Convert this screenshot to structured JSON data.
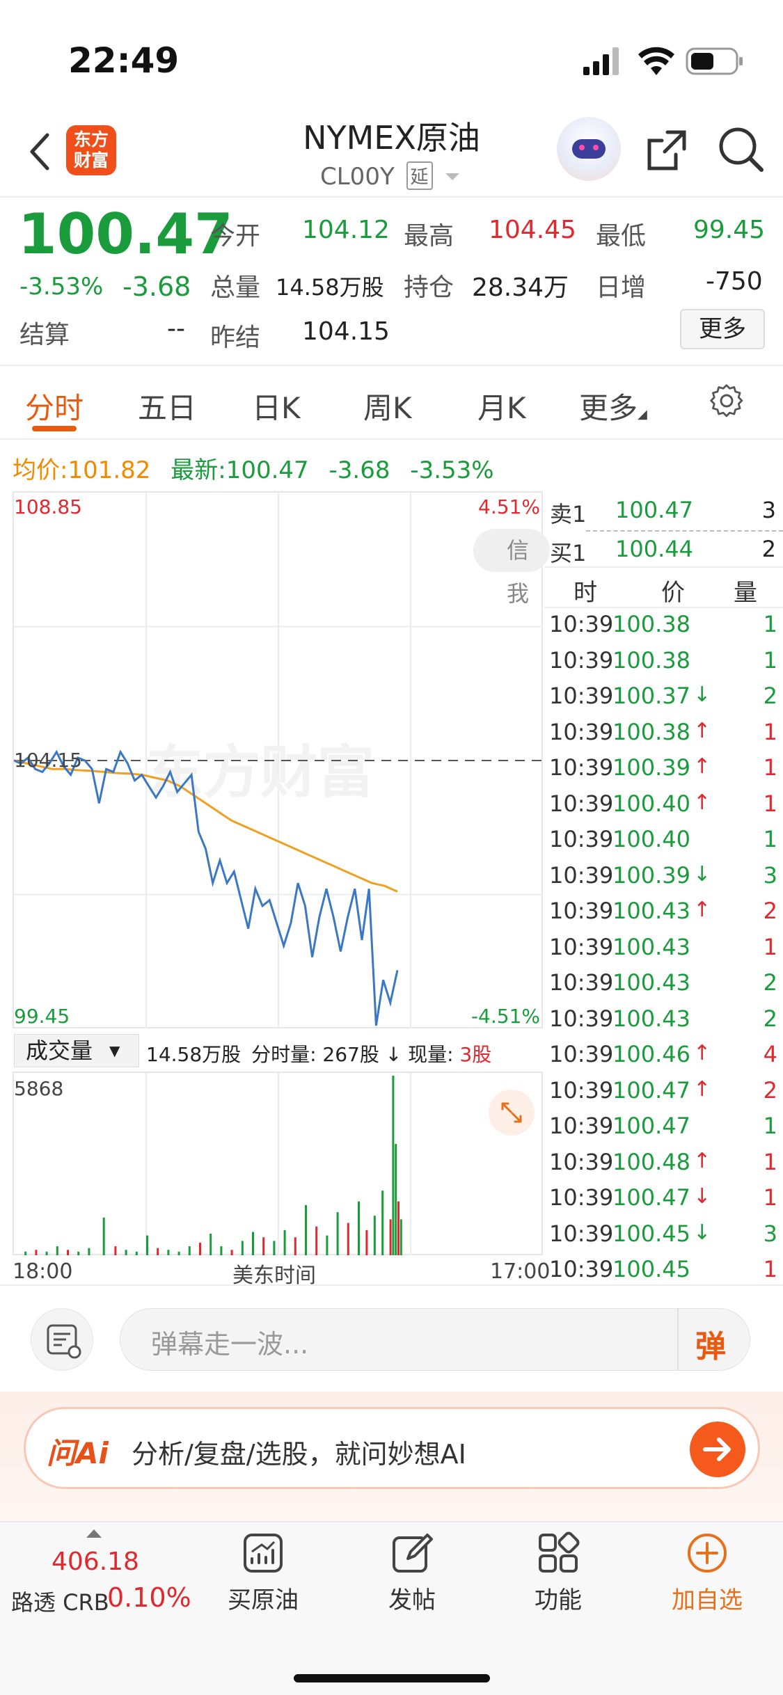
{
  "status_bar": {
    "time": "22:49"
  },
  "header": {
    "brand_logo_text": "东方\n财富",
    "title": "NYMEX原油",
    "symbol": "CL00Y",
    "delay_badge": "延"
  },
  "quote": {
    "price": "100.47",
    "change_pct": "-3.53%",
    "change": "-3.68",
    "settlement_label": "结算",
    "settlement_value": "--",
    "open_label": "今开",
    "open_value": "104.12",
    "high_label": "最高",
    "high_value": "104.45",
    "low_label": "最低",
    "low_value": "99.45",
    "volume_label": "总量",
    "volume_value": "14.58万股",
    "position_label": "持仓",
    "position_value": "28.34万",
    "daily_inc_label": "日增",
    "daily_inc_value": "-750",
    "prev_settle_label": "昨结",
    "prev_settle_value": "104.15",
    "more_button": "更多"
  },
  "tabs": [
    {
      "label": "分时",
      "active": true
    },
    {
      "label": "五日",
      "active": false
    },
    {
      "label": "日K",
      "active": false
    },
    {
      "label": "周K",
      "active": false
    },
    {
      "label": "月K",
      "active": false
    },
    {
      "label": "更多",
      "active": false
    }
  ],
  "info_line": {
    "avg_label": "均价:",
    "avg_value": "101.82",
    "latest_label": "最新:",
    "latest_value": "100.47",
    "latest_change": "-3.68",
    "latest_pct": "-3.53%"
  },
  "chart_data": {
    "type": "line",
    "y_max_label": "108.85",
    "y_min_label": "99.45",
    "y_mid_label": "104.15",
    "pct_max_label": "4.51%",
    "pct_min_label": "-4.51%",
    "ylim": [
      99.45,
      108.85
    ],
    "watermark": "东方财富",
    "pill_text": "信我",
    "x_start_label": "18:00",
    "x_mid_label": "美东时间",
    "x_end_label": "17:00",
    "colors": {
      "price": "#3a78c4",
      "avg": "#f0a020"
    },
    "series": [
      {
        "values": [
          104.15,
          104.1,
          104.2,
          104.0,
          103.95,
          104.1,
          104.3,
          104.05,
          103.9,
          104.2,
          104.15,
          104.0,
          103.4,
          104.0,
          103.95,
          104.3,
          104.1,
          103.8,
          103.9,
          103.7,
          103.5,
          103.7,
          103.95,
          103.6,
          103.75,
          103.9,
          102.9,
          102.6,
          102.0,
          102.4,
          102.0,
          102.2,
          101.7,
          101.2,
          101.9,
          101.6,
          101.7,
          101.3,
          100.9,
          101.3,
          102.0,
          101.6,
          100.7,
          101.4,
          101.9,
          101.4,
          100.8,
          101.4,
          101.9,
          101.0,
          101.9,
          99.5,
          100.3,
          99.9,
          100.47
        ]
      },
      {
        "values": [
          104.15,
          104.1,
          104.05,
          104.0,
          104.0,
          103.98,
          103.97,
          103.95,
          103.93,
          103.92,
          103.9,
          103.85,
          103.8,
          103.7,
          103.55,
          103.4,
          103.25,
          103.1,
          103.0,
          102.9,
          102.8,
          102.7,
          102.6,
          102.5,
          102.4,
          102.3,
          102.2,
          102.1,
          102.0,
          101.95,
          101.85
        ]
      }
    ]
  },
  "volume_panel": {
    "selector_label": "成交量",
    "total": "14.58万股",
    "minute_vol": "分时量: 267股",
    "current_label": "现量:",
    "current_value": "3股",
    "y_max": "5868",
    "bars": [
      {
        "x": 0.02,
        "h": 0.02,
        "c": "g"
      },
      {
        "x": 0.04,
        "h": 0.03,
        "c": "r"
      },
      {
        "x": 0.06,
        "h": 0.02,
        "c": "g"
      },
      {
        "x": 0.08,
        "h": 0.05,
        "c": "g"
      },
      {
        "x": 0.1,
        "h": 0.03,
        "c": "r"
      },
      {
        "x": 0.12,
        "h": 0.02,
        "c": "g"
      },
      {
        "x": 0.14,
        "h": 0.04,
        "c": "g"
      },
      {
        "x": 0.168,
        "h": 0.21,
        "c": "g"
      },
      {
        "x": 0.19,
        "h": 0.05,
        "c": "r"
      },
      {
        "x": 0.21,
        "h": 0.03,
        "c": "g"
      },
      {
        "x": 0.23,
        "h": 0.02,
        "c": "g"
      },
      {
        "x": 0.25,
        "h": 0.11,
        "c": "g"
      },
      {
        "x": 0.27,
        "h": 0.04,
        "c": "r"
      },
      {
        "x": 0.29,
        "h": 0.03,
        "c": "g"
      },
      {
        "x": 0.31,
        "h": 0.02,
        "c": "g"
      },
      {
        "x": 0.33,
        "h": 0.05,
        "c": "g"
      },
      {
        "x": 0.35,
        "h": 0.07,
        "c": "r"
      },
      {
        "x": 0.37,
        "h": 0.12,
        "c": "g"
      },
      {
        "x": 0.39,
        "h": 0.05,
        "c": "g"
      },
      {
        "x": 0.41,
        "h": 0.03,
        "c": "r"
      },
      {
        "x": 0.43,
        "h": 0.08,
        "c": "g"
      },
      {
        "x": 0.45,
        "h": 0.13,
        "c": "g"
      },
      {
        "x": 0.47,
        "h": 0.1,
        "c": "r"
      },
      {
        "x": 0.49,
        "h": 0.08,
        "c": "g"
      },
      {
        "x": 0.51,
        "h": 0.14,
        "c": "g"
      },
      {
        "x": 0.53,
        "h": 0.1,
        "c": "r"
      },
      {
        "x": 0.55,
        "h": 0.28,
        "c": "g"
      },
      {
        "x": 0.57,
        "h": 0.16,
        "c": "r"
      },
      {
        "x": 0.59,
        "h": 0.11,
        "c": "g"
      },
      {
        "x": 0.61,
        "h": 0.24,
        "c": "g"
      },
      {
        "x": 0.63,
        "h": 0.18,
        "c": "r"
      },
      {
        "x": 0.65,
        "h": 0.3,
        "c": "g"
      },
      {
        "x": 0.665,
        "h": 0.14,
        "c": "r"
      },
      {
        "x": 0.68,
        "h": 0.22,
        "c": "g"
      },
      {
        "x": 0.695,
        "h": 0.36,
        "c": "g"
      },
      {
        "x": 0.71,
        "h": 0.2,
        "c": "r"
      },
      {
        "x": 0.715,
        "h": 1.0,
        "c": "g"
      },
      {
        "x": 0.72,
        "h": 0.62,
        "c": "g"
      },
      {
        "x": 0.725,
        "h": 0.3,
        "c": "r"
      },
      {
        "x": 0.73,
        "h": 0.2,
        "c": "g"
      }
    ]
  },
  "order_book": {
    "sell1_label": "卖1",
    "sell1_price": "100.47",
    "sell1_vol": "3",
    "buy1_label": "买1",
    "buy1_price": "100.44",
    "buy1_vol": "2"
  },
  "trades_header": {
    "time": "时",
    "price": "价",
    "volume": "量"
  },
  "trades": [
    {
      "time": "10:39",
      "price": "100.38",
      "arrow": "",
      "vol": "1",
      "dir": "g"
    },
    {
      "time": "10:39",
      "price": "100.38",
      "arrow": "",
      "vol": "1",
      "dir": "g"
    },
    {
      "time": "10:39",
      "price": "100.37",
      "arrow": "↓",
      "vol": "2",
      "dir": "g"
    },
    {
      "time": "10:39",
      "price": "100.38",
      "arrow": "↑",
      "vol": "1",
      "dir": "r"
    },
    {
      "time": "10:39",
      "price": "100.39",
      "arrow": "↑",
      "vol": "1",
      "dir": "r"
    },
    {
      "time": "10:39",
      "price": "100.40",
      "arrow": "↑",
      "vol": "1",
      "dir": "r"
    },
    {
      "time": "10:39",
      "price": "100.40",
      "arrow": "",
      "vol": "1",
      "dir": "g"
    },
    {
      "time": "10:39",
      "price": "100.39",
      "arrow": "↓",
      "vol": "3",
      "dir": "g"
    },
    {
      "time": "10:39",
      "price": "100.43",
      "arrow": "↑",
      "vol": "2",
      "dir": "r"
    },
    {
      "time": "10:39",
      "price": "100.43",
      "arrow": "",
      "vol": "1",
      "dir": "r"
    },
    {
      "time": "10:39",
      "price": "100.43",
      "arrow": "",
      "vol": "2",
      "dir": "g"
    },
    {
      "time": "10:39",
      "price": "100.43",
      "arrow": "",
      "vol": "2",
      "dir": "g"
    },
    {
      "time": "10:39",
      "price": "100.46",
      "arrow": "↑",
      "vol": "4",
      "dir": "r"
    },
    {
      "time": "10:39",
      "price": "100.47",
      "arrow": "↑",
      "vol": "2",
      "dir": "r"
    },
    {
      "time": "10:39",
      "price": "100.47",
      "arrow": "",
      "vol": "1",
      "dir": "g"
    },
    {
      "time": "10:39",
      "price": "100.48",
      "arrow": "↑",
      "vol": "1",
      "dir": "r"
    },
    {
      "time": "10:39",
      "price": "100.47",
      "arrow": "↓",
      "vol": "1",
      "dir": "r"
    },
    {
      "time": "10:39",
      "price": "100.45",
      "arrow": "↓",
      "vol": "3",
      "dir": "g"
    },
    {
      "time": "10:39",
      "price": "100.45",
      "arrow": "",
      "vol": "1",
      "dir": "r"
    }
  ],
  "comment_bar": {
    "placeholder": "弹幕走一波...",
    "danmu_button": "弹"
  },
  "ai_bar": {
    "brand": "问Ai",
    "prompt": "分析/复盘/选股，就问妙想AI"
  },
  "bottom_nav": {
    "index_value": "406.18",
    "index_name": "路透 CRB",
    "index_pct": "0.10%",
    "items": [
      {
        "label": "买原油"
      },
      {
        "label": "发帖"
      },
      {
        "label": "功能"
      },
      {
        "label": "加自选"
      }
    ]
  }
}
